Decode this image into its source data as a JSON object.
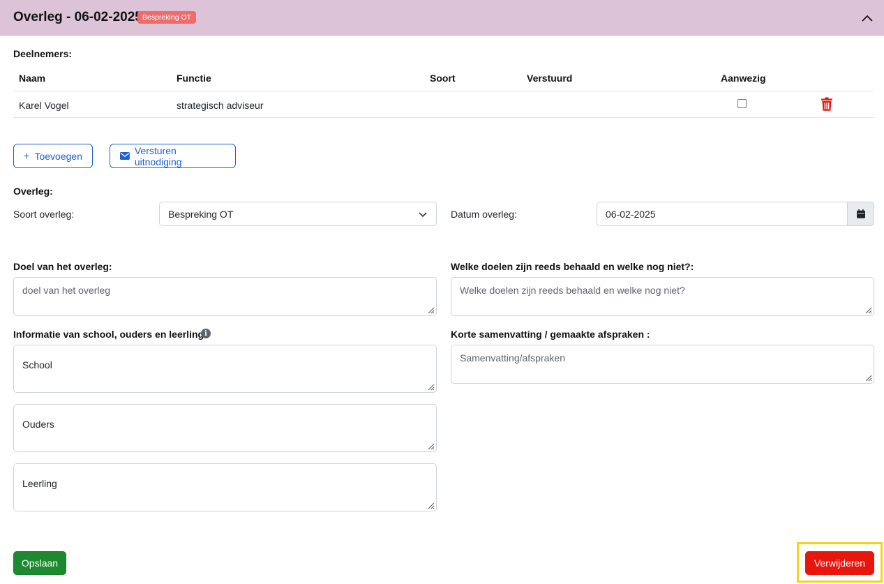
{
  "header": {
    "title": "Overleg - 06-02-2025",
    "badge": "Bespreking OT"
  },
  "participants": {
    "label": "Deelnemers:",
    "columns": [
      "Naam",
      "Functie",
      "Soort",
      "Verstuurd",
      "Aanwezig"
    ],
    "rows": [
      {
        "naam": "Karel Vogel",
        "functie": "strategisch adviseur",
        "soort": "",
        "verstuurd": "",
        "aanwezig": false
      }
    ],
    "add_button": "Toevoegen",
    "invite_button": "Versturen uitnodiging"
  },
  "meeting": {
    "label": "Overleg:",
    "type_label": "Soort overleg:",
    "type_value": "Bespreking OT",
    "date_label": "Datum overleg:",
    "date_value": "06-02-2025"
  },
  "fields": {
    "goal_label": "Doel van het overleg:",
    "goal_placeholder": "doel van het overleg",
    "goals_achieved_label": "Welke doelen zijn reeds behaald en welke nog niet?:",
    "goals_achieved_placeholder": "Welke doelen zijn reeds behaald en welke nog niet?",
    "info_label": "Informatie van school, ouders en leerling",
    "school_placeholder": "School",
    "parents_placeholder": "Ouders",
    "student_placeholder": "Leerling",
    "summary_label": "Korte samenvatting / gemaakte afspraken :",
    "summary_placeholder": "Samenvatting/afspraken"
  },
  "actions": {
    "save": "Opslaan",
    "delete": "Verwijderen"
  },
  "colors": {
    "header_bg": "#dcc3d8",
    "badge_bg": "#ee6c6c",
    "primary": "#1d5fd6",
    "success": "#1e8a30",
    "danger": "#e8160c",
    "highlight": "#f5d416"
  }
}
